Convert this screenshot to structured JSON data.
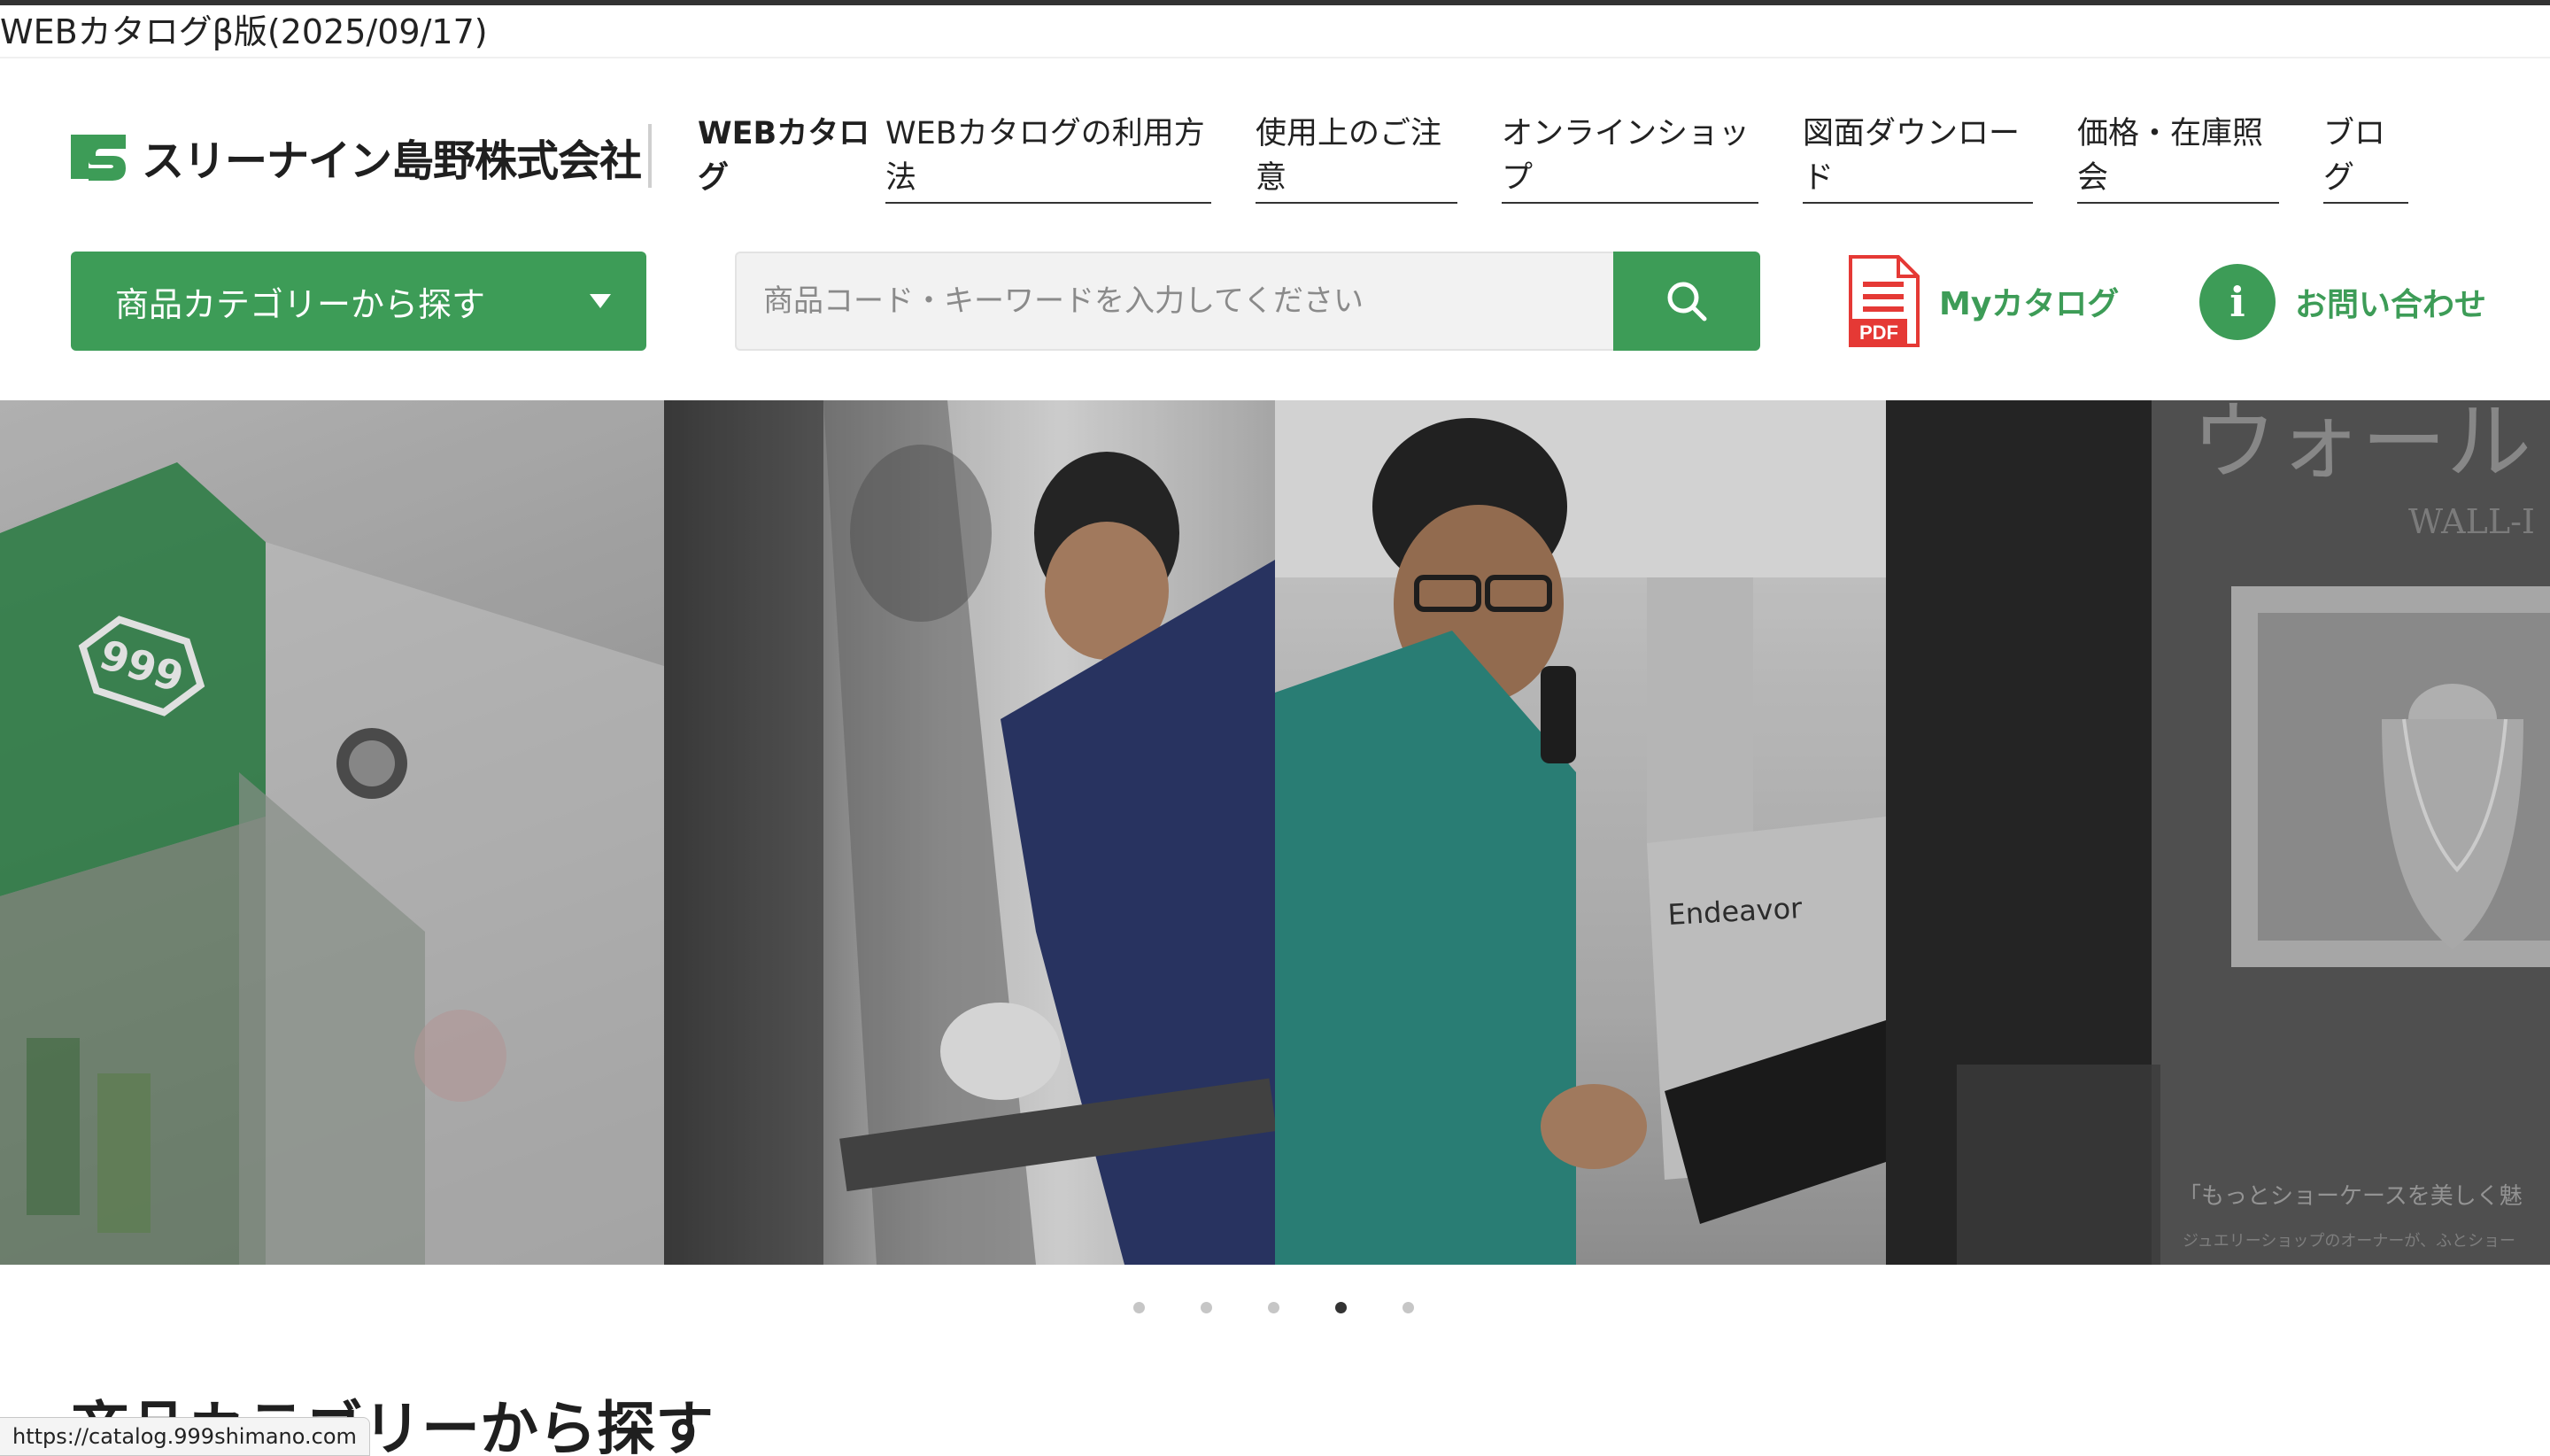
{
  "browser": {
    "page_title": "WEBカタログβ版(2025/09/17)",
    "status_url": "https://catalog.999shimano.com"
  },
  "header": {
    "logo_text": "スリーナイン島野株式会社",
    "current_section": "WEBカタログ",
    "nav": [
      {
        "label": "WEBカタログの利用方法"
      },
      {
        "label": "使用上のご注意"
      },
      {
        "label": "オンラインショップ"
      },
      {
        "label": "図面ダウンロード"
      },
      {
        "label": "価格・在庫照会"
      },
      {
        "label": "ブログ"
      }
    ]
  },
  "search": {
    "category_button": "商品カテゴリーから探す",
    "placeholder": "商品コード・キーワードを入力してください",
    "mycatalog_label": "Myカタログ",
    "pdf_badge": "PDF",
    "contact_label": "お問い合わせ",
    "contact_icon": "i"
  },
  "hero": {
    "logo_badge": "999",
    "computer_label": "Endeavor",
    "showcase_title": "ウォール",
    "showcase_sub": "WALL-I",
    "showcase_caption": "「もっとショーケースを美しく魅",
    "showcase_caption2": "ジュエリーショップのオーナーが、ふとショー",
    "dots_total": 5,
    "active_slide": 4
  },
  "main": {
    "section_heading": "商品カテゴリーから探す"
  },
  "colors": {
    "brand_green": "#3d9c57",
    "pdf_red": "#e53935",
    "text": "#222222"
  },
  "icons": [
    "logo-mark-icon",
    "chevron-down-icon",
    "search-icon",
    "pdf-icon",
    "info-icon"
  ]
}
